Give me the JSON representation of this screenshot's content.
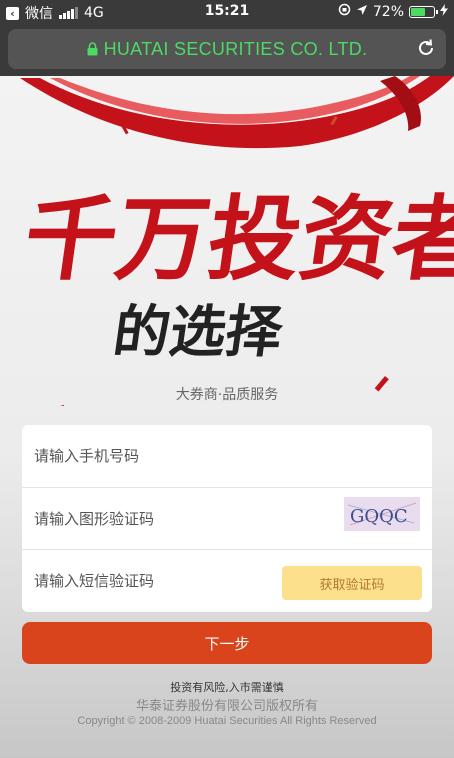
{
  "status_bar": {
    "back_app_label": "微信",
    "network": "4G",
    "time": "15:21",
    "battery_percent": "72%",
    "battery_level": 0.72
  },
  "browser": {
    "url_text": "HUATAI SECURITIES CO. LTD."
  },
  "hero": {
    "slogan_line1": "千万投资者",
    "slogan_line2": "的选择",
    "tagline": "大券商·品质服务"
  },
  "form": {
    "phone_placeholder": "请输入手机号码",
    "captcha_placeholder": "请输入图形验证码",
    "captcha_text": "GQQC",
    "sms_placeholder": "请输入短信验证码",
    "sms_button_label": "获取验证码",
    "next_button_label": "下一步"
  },
  "footer": {
    "risk_notice": "投资有风险,入市需谨慎",
    "company": "华泰证券股份有限公司版权所有",
    "copyright": "Copyright © 2008-2009 Huatai Securities All Rights Reserved"
  },
  "colors": {
    "accent": "#d9441c",
    "sms_button_bg": "#fde08c",
    "url_green": "#4cd964"
  }
}
